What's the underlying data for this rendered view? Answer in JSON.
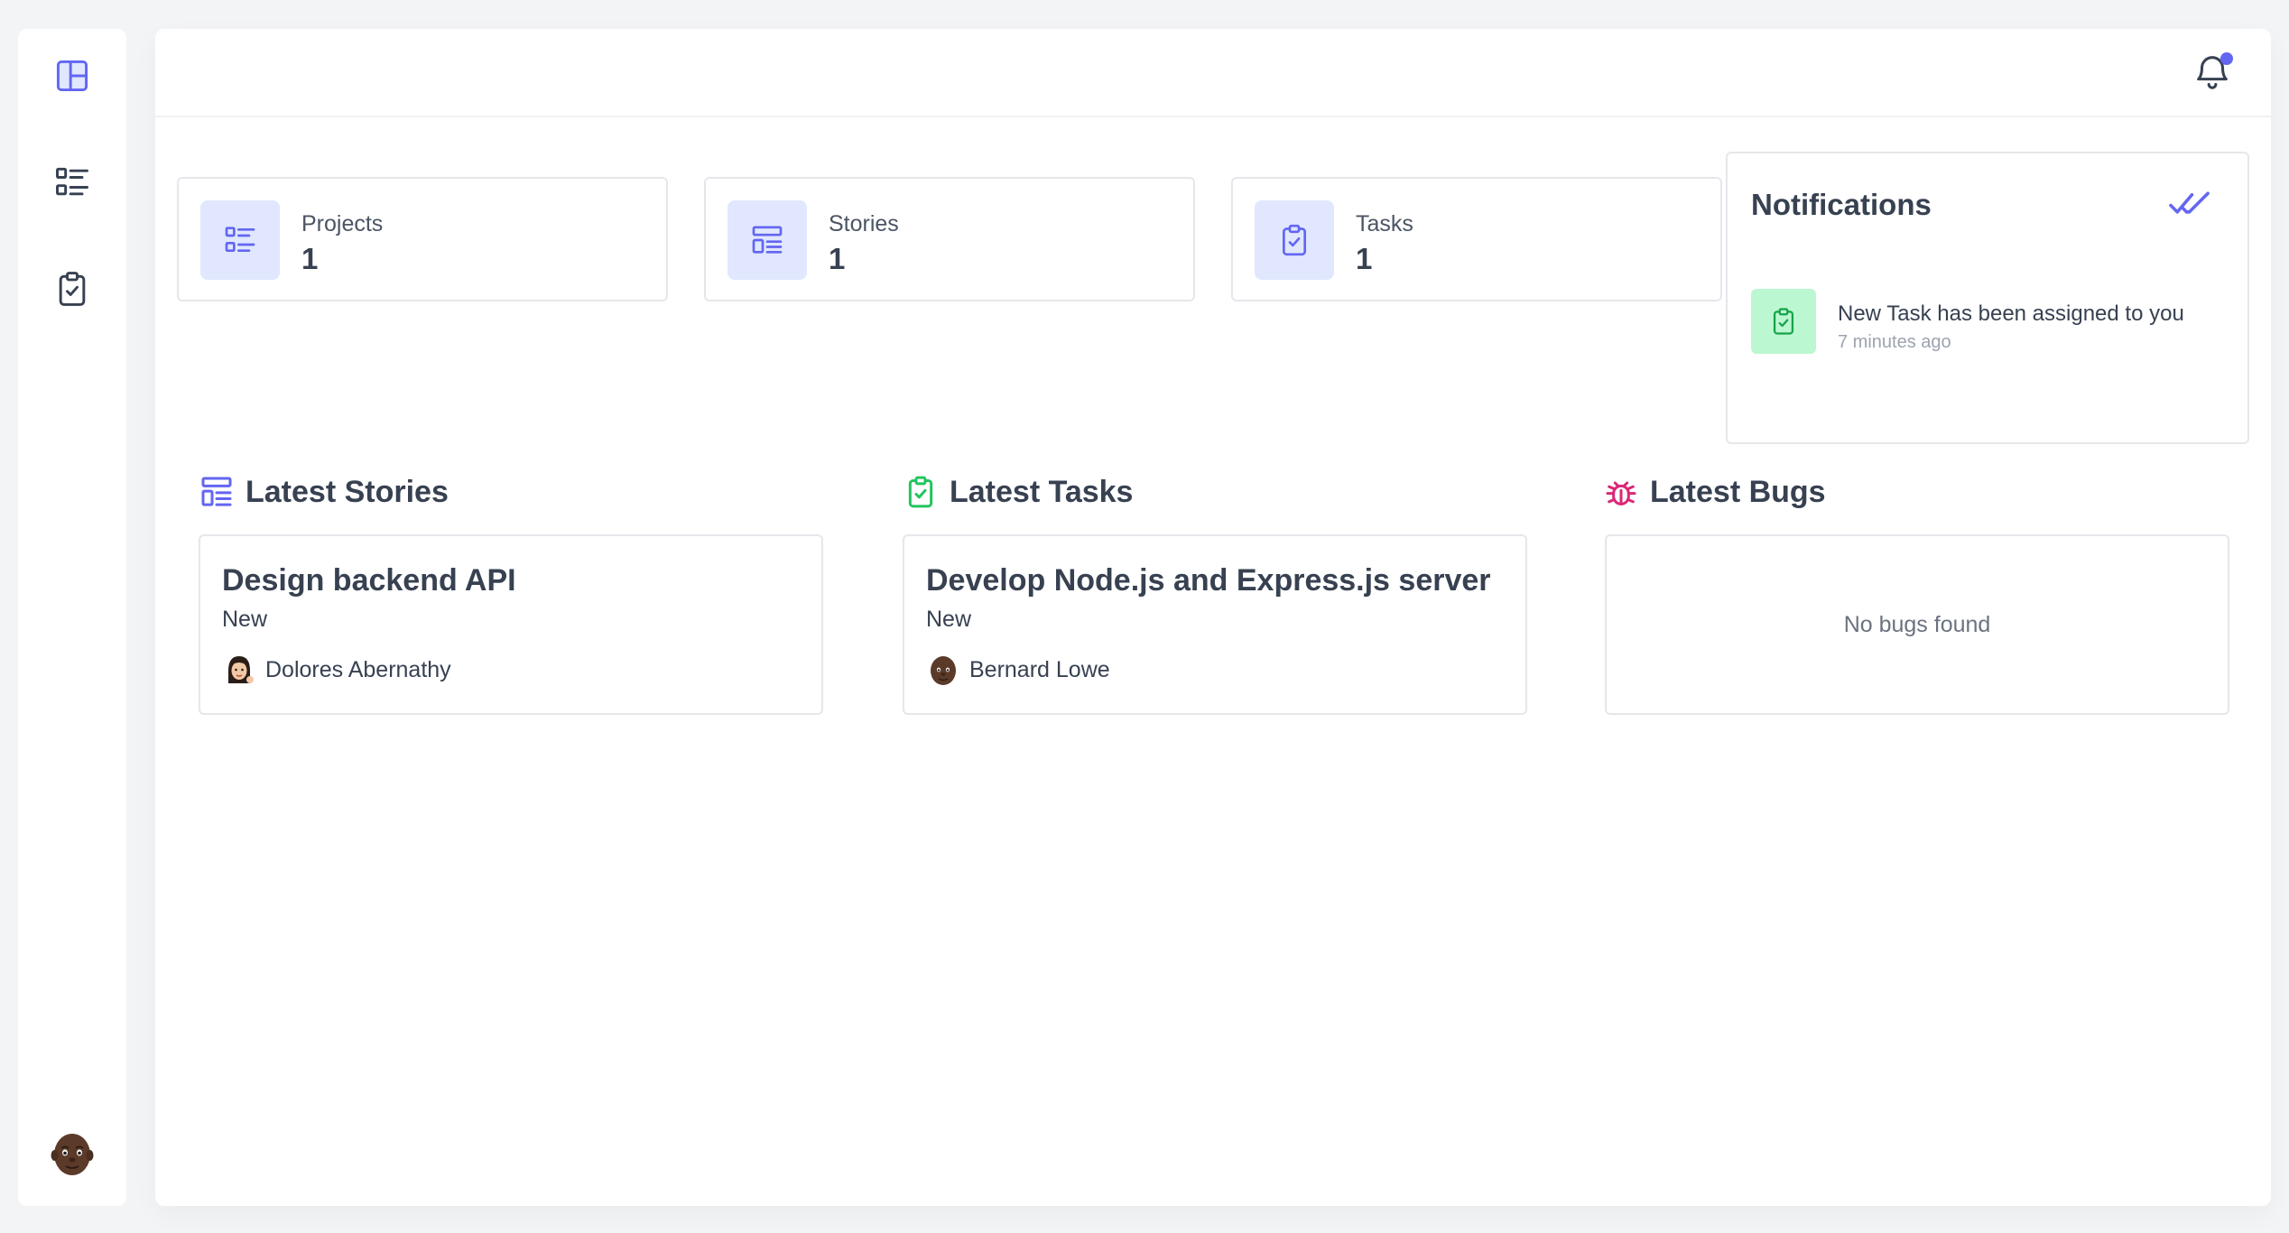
{
  "colors": {
    "accent": "#6366f1",
    "accent_light": "#e0e7ff",
    "success": "#22c55e",
    "success_light": "#bbf7d0",
    "danger": "#db2777"
  },
  "sidebar": {
    "items": [
      {
        "icon": "layout-dashboard-icon",
        "active": true
      },
      {
        "icon": "list-icon",
        "active": false
      },
      {
        "icon": "clipboard-check-icon",
        "active": false
      }
    ],
    "user_avatar": "avatar-icon"
  },
  "header": {
    "notification_icon": "bell-icon",
    "has_unread": true
  },
  "stats": [
    {
      "label": "Projects",
      "value": "1",
      "icon": "list-icon"
    },
    {
      "label": "Stories",
      "value": "1",
      "icon": "layout-list-icon"
    },
    {
      "label": "Tasks",
      "value": "1",
      "icon": "clipboard-check-icon"
    }
  ],
  "notifications": {
    "title": "Notifications",
    "mark_all_icon": "double-check-icon",
    "items": [
      {
        "text": "New Task has been assigned to you",
        "time": "7 minutes ago",
        "icon": "clipboard-check-icon"
      }
    ]
  },
  "sections": {
    "stories": {
      "title": "Latest Stories",
      "icon": "layout-list-icon",
      "item": {
        "title": "Design backend API",
        "status": "New",
        "assignee": "Dolores Abernathy"
      }
    },
    "tasks": {
      "title": "Latest Tasks",
      "icon": "clipboard-check-icon",
      "item": {
        "title": "Develop Node.js and Express.js server",
        "status": "New",
        "assignee": "Bernard Lowe"
      }
    },
    "bugs": {
      "title": "Latest Bugs",
      "icon": "bug-icon",
      "empty_text": "No bugs found"
    }
  }
}
